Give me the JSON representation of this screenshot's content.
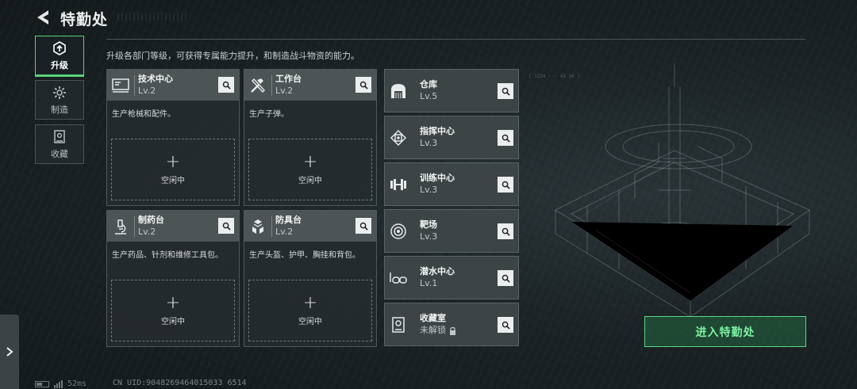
{
  "header": {
    "title": "特勤处",
    "back_icon": "back-arrow-icon"
  },
  "left_tabs": [
    {
      "label": "升级",
      "icon": "upgrade-icon",
      "active": true
    },
    {
      "label": "制造",
      "icon": "manufacture-gear-icon",
      "active": false
    },
    {
      "label": "收藏",
      "icon": "collection-icon",
      "active": false
    }
  ],
  "description": "升级各部门等级，可获得专属能力提升，和制造战斗物资的能力。",
  "cards": [
    {
      "name": "技术中心",
      "level": "Lv.2",
      "desc": "生产枪械和配件。",
      "slot_text": "空闲中",
      "icon": "tech-center-icon"
    },
    {
      "name": "工作台",
      "level": "Lv.2",
      "desc": "生产子弹。",
      "slot_text": "空闲中",
      "icon": "workbench-tools-icon"
    },
    {
      "name": "制药台",
      "level": "Lv.2",
      "desc": "生产药品、针剂和维修工具包。",
      "slot_text": "空闲中",
      "icon": "microscope-icon"
    },
    {
      "name": "防具台",
      "level": "Lv.2",
      "desc": "生产头盔、护甲、胸挂和背包。",
      "slot_text": "空闲中",
      "icon": "armor-cubes-icon"
    }
  ],
  "list": [
    {
      "name": "仓库",
      "level": "Lv.5",
      "icon": "warehouse-icon"
    },
    {
      "name": "指挥中心",
      "level": "Lv.3",
      "icon": "command-chip-icon"
    },
    {
      "name": "训练中心",
      "level": "Lv.3",
      "icon": "dumbbell-icon"
    },
    {
      "name": "靶场",
      "level": "Lv.3",
      "icon": "target-icon"
    },
    {
      "name": "潜水中心",
      "level": "Lv.1",
      "icon": "diving-goggles-icon"
    },
    {
      "name": "收藏室",
      "level": "未解锁",
      "icon": "trophy-room-icon",
      "locked": true
    }
  ],
  "enter_button": "进入特勤处",
  "footer": {
    "ping": "52ms",
    "uid": "CN UID:9048269464015033 6514"
  },
  "colors": {
    "accent": "#59d27a",
    "enter_text": "#7cf1a1",
    "card_header": "#4c5456"
  }
}
